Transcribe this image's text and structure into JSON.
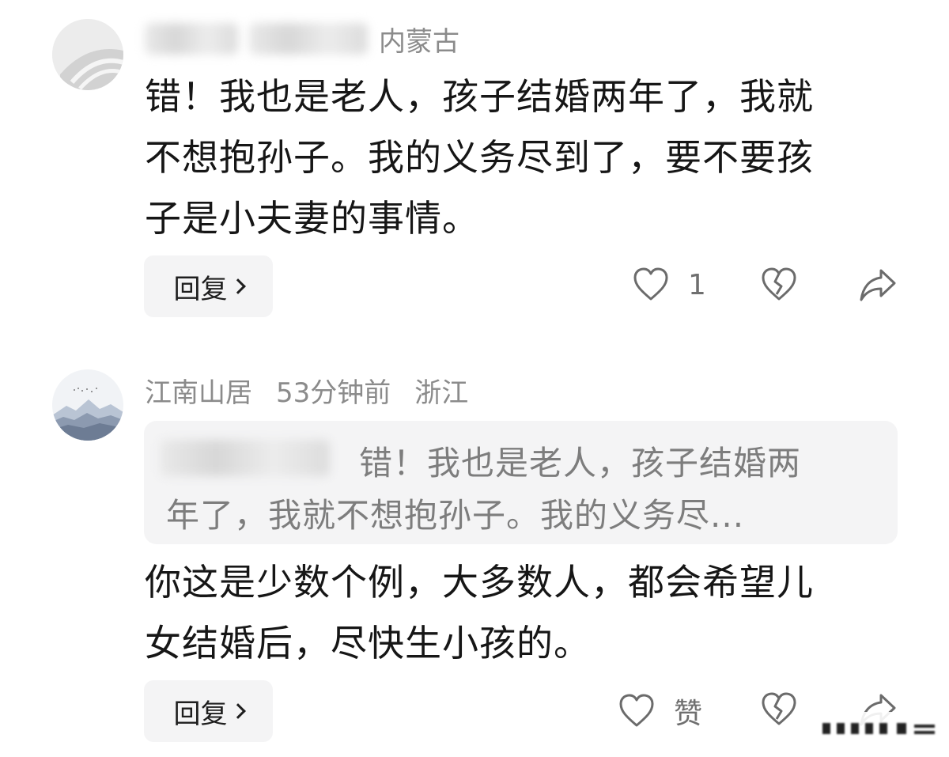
{
  "comments": [
    {
      "location": "内蒙古",
      "text_lines": [
        "错！我也是老人，孩子结婚两年了，我就",
        "不想抱孙子。我的义务尽到了，要不要孩",
        "子是小夫妻的事情。"
      ],
      "reply_label": "回复",
      "like_count": "1"
    },
    {
      "username": "江南山居",
      "time": "53分钟前",
      "location": "浙江",
      "quote_lines": [
        "错！我也是老人，孩子结婚两",
        "年了，我就不想抱孙子。我的义务尽..."
      ],
      "text_lines": [
        "你这是少数个例，大多数人，都会希望儿",
        "女结婚后，尽快生小孩的。"
      ],
      "reply_label": "回复",
      "like_label": "赞"
    }
  ],
  "icons": {
    "like": "heart-outline-icon",
    "dislike": "broken-heart-icon",
    "share": "share-arrow-icon",
    "chevron": "chevron-right-icon"
  }
}
